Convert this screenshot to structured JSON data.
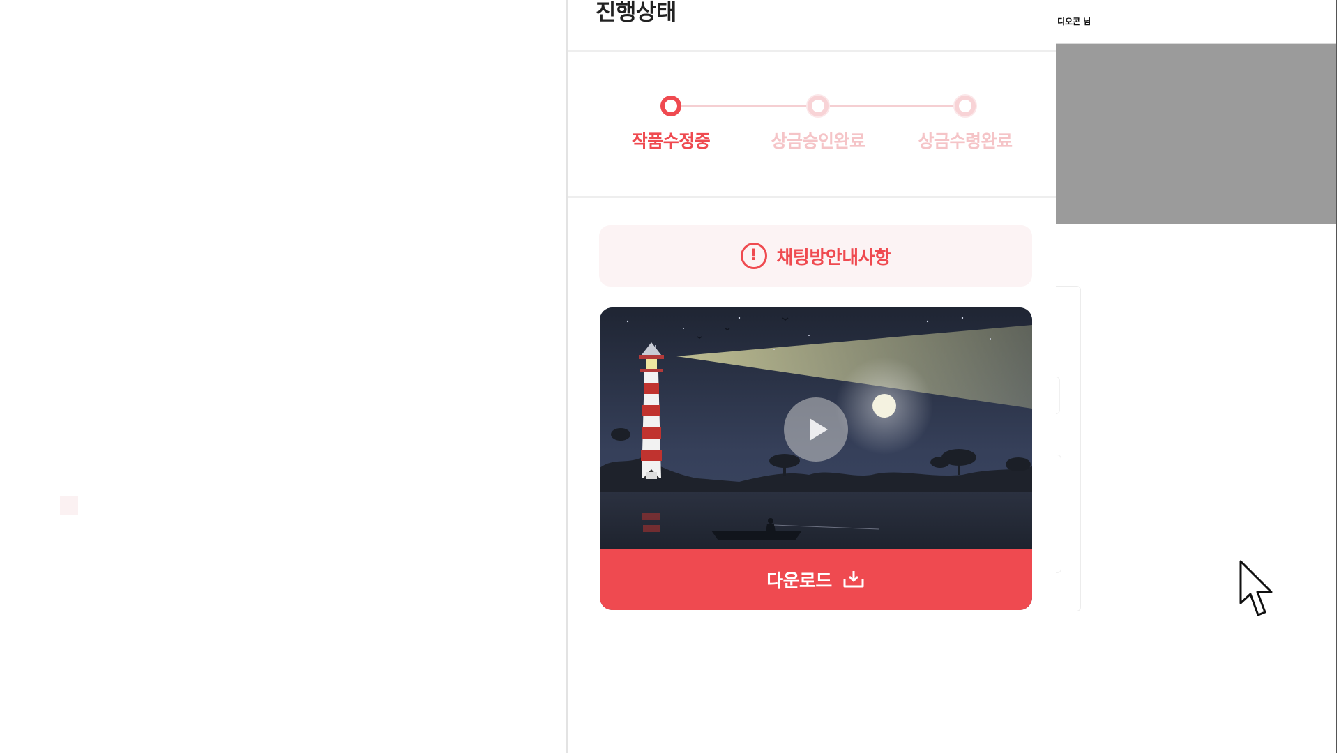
{
  "panel": {
    "title": "진행상태"
  },
  "stepper": {
    "steps": [
      {
        "label": "작품수정중",
        "active": true
      },
      {
        "label": "상금승인완료",
        "active": false
      },
      {
        "label": "상금수령완료",
        "active": false
      }
    ]
  },
  "notice": {
    "label": "채팅방안내사항",
    "icon": "exclamation-circle-icon"
  },
  "video": {
    "thumbnail": "lighthouse-night-scene",
    "play_icon": "play-icon"
  },
  "download": {
    "label": "다운로드",
    "icon": "download-icon"
  },
  "right_panel": {
    "user_name": "디오콘 님"
  },
  "colors": {
    "accent": "#ef4a50",
    "accent_light": "#f5c4c7",
    "notice_bg": "#fcf3f4"
  }
}
